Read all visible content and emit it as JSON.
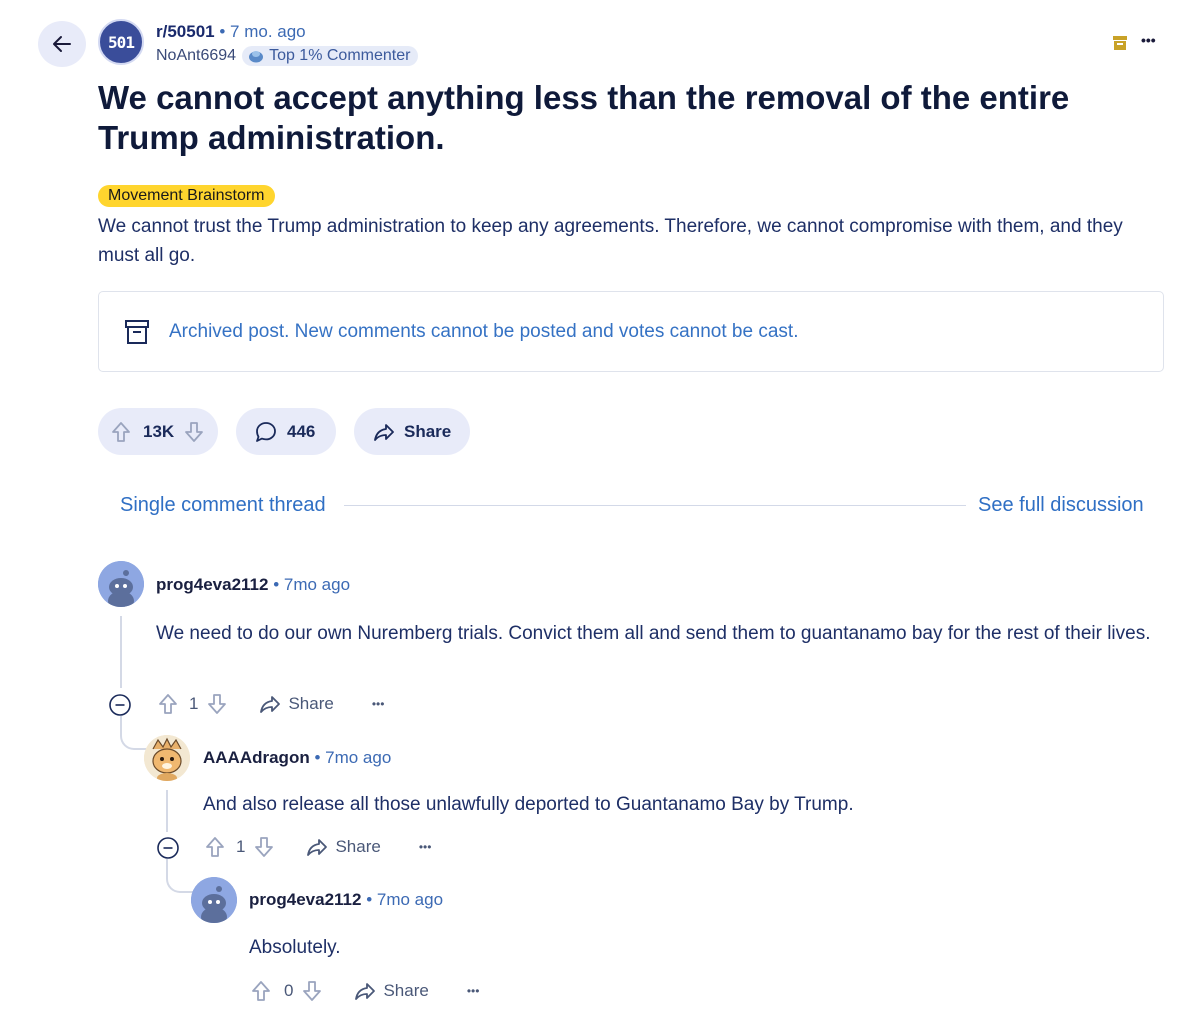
{
  "post": {
    "subreddit": "r/50501",
    "sub_icon_text": "501",
    "time_sep": " • ",
    "time": "7 mo. ago",
    "author": "NoAnt6694",
    "author_badge": "Top 1% Commenter",
    "title": "We cannot accept anything less than the removal of the entire Trump administration.",
    "flair": "Movement Brainstorm",
    "body": "We cannot trust the Trump administration to keep any agreements. Therefore, we cannot compromise with them, and they must all go.",
    "archived_notice": "Archived post. New comments cannot be posted and votes cannot be cast.",
    "score": "13K",
    "comments": "446",
    "share_label": "Share"
  },
  "thread": {
    "single_label": "Single comment thread",
    "full_label": "See full discussion"
  },
  "comments": [
    {
      "user": "prog4eva2112",
      "sep": " • ",
      "time": "7mo ago",
      "body": "We need to do our own Nuremberg trials. Convict them all and send them to guantanamo bay for the rest of their lives.",
      "score": "1",
      "share": "Share",
      "more": "•••"
    },
    {
      "user": "AAAAdragon",
      "sep": " • ",
      "time": "7mo ago",
      "body": "And also release all those unlawfully deported to Guantanamo Bay by Trump.",
      "score": "1",
      "share": "Share",
      "more": "•••"
    },
    {
      "user": "prog4eva2112",
      "sep": " • ",
      "time": "7mo ago",
      "body": "Absolutely.",
      "score": "0",
      "share": "Share",
      "more": "•••"
    }
  ],
  "toolbar": {
    "more": "•••"
  },
  "colors": {
    "accent": "#2f6fc4",
    "flair": "#ffd52e",
    "pill_bg": "#e8ebf9",
    "archive_icon": "#c9a227"
  }
}
